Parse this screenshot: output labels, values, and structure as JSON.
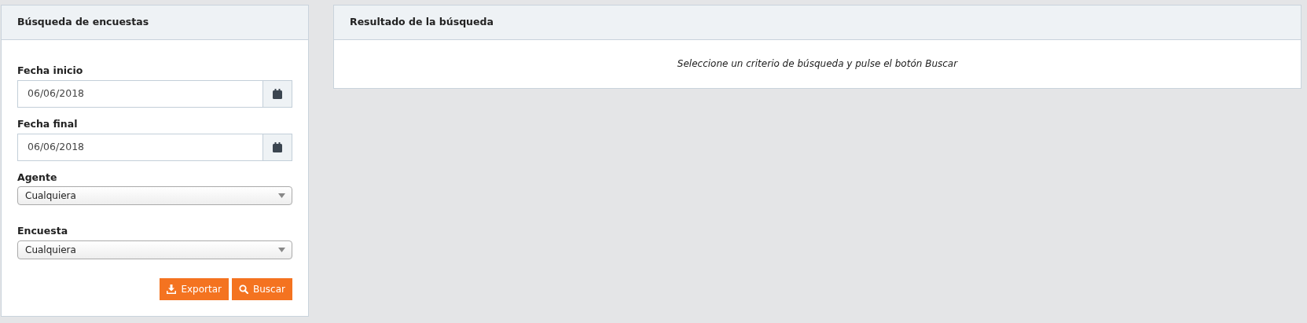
{
  "search_panel": {
    "title": "Búsqueda de encuestas",
    "fields": [
      {
        "kind": "date",
        "label": "Fecha inicio",
        "value": "06/06/2018"
      },
      {
        "kind": "date",
        "label": "Fecha final",
        "value": "06/06/2018"
      },
      {
        "kind": "select",
        "label": "Agente",
        "value": "Cualquiera"
      },
      {
        "kind": "select",
        "label": "Encuesta",
        "value": "Cualquiera"
      }
    ],
    "buttons": [
      {
        "kind": "export",
        "label": "Exportar"
      },
      {
        "kind": "search",
        "label": "Buscar"
      }
    ]
  },
  "results_panel": {
    "title": "Resultado de la búsqueda",
    "message": "Seleccione un criterio de búsqueda y pulse el botón Buscar"
  }
}
